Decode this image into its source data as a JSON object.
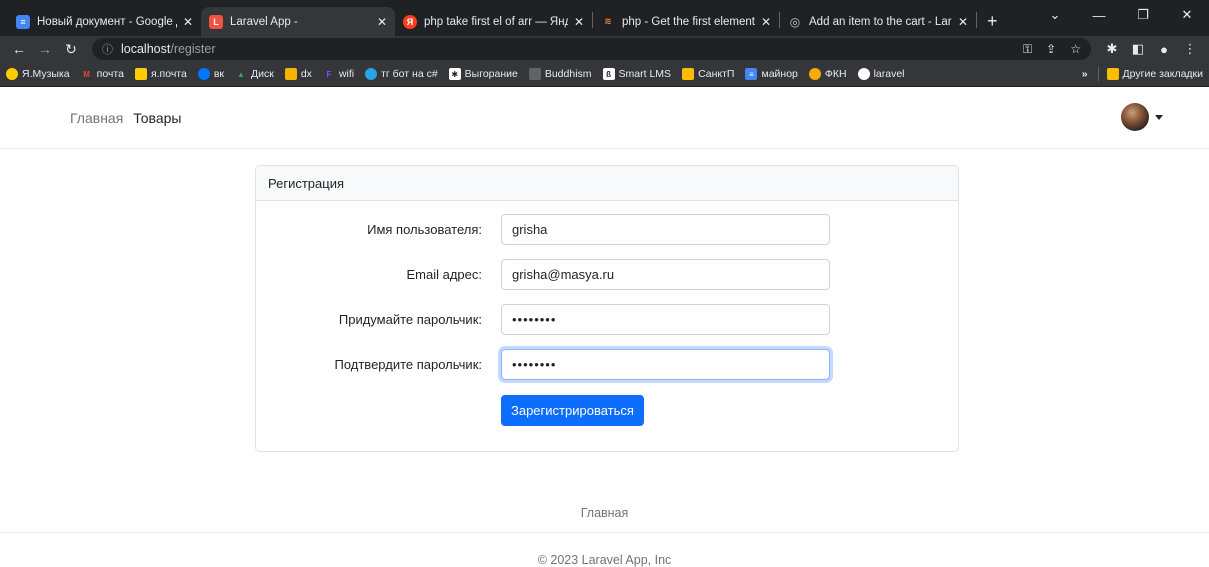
{
  "browser": {
    "tabs": [
      {
        "title": "Новый документ - Google Док",
        "favicon_color": "#4285f4",
        "favicon_glyph": "≡",
        "active": false
      },
      {
        "title": "Laravel App -",
        "favicon_color": "#f05340",
        "favicon_glyph": "L",
        "active": true
      },
      {
        "title": "php take first el of arr — Яндек",
        "favicon_color": "#fc3f1d",
        "favicon_glyph": "Я",
        "active": false
      },
      {
        "title": "php - Get the first element of ar",
        "favicon_color": "#f48024",
        "favicon_glyph": "S",
        "active": false
      },
      {
        "title": "Add an item to the cart - Larave",
        "favicon_color": "#9aa0a6",
        "favicon_glyph": "◎",
        "active": false
      }
    ],
    "url_host": "localhost",
    "url_path": "/register",
    "bookmarks": [
      {
        "label": "Я.Музыка",
        "color": "#ffcc00"
      },
      {
        "label": "почта",
        "color": "#ea4335"
      },
      {
        "label": "я.почта",
        "color": "#ffcc00"
      },
      {
        "label": "вк",
        "color": "#0077ff"
      },
      {
        "label": "Диск",
        "color": "#34a853"
      },
      {
        "label": "dx",
        "color": "#f4b400"
      },
      {
        "label": "wifi",
        "color": "#7c4dff"
      },
      {
        "label": "тг бот на c#",
        "color": "#26a5e4"
      },
      {
        "label": "Выгорание",
        "color": "#ffffff"
      },
      {
        "label": "Buddhism",
        "color": "#5f6368"
      },
      {
        "label": "Smart LMS",
        "color": "#ffffff"
      },
      {
        "label": "СанктП",
        "color": "#fbbc04"
      },
      {
        "label": "майнор",
        "color": "#4285f4"
      },
      {
        "label": "ФКН",
        "color": "#f9ab00"
      },
      {
        "label": "laravel",
        "color": "#ffffff"
      }
    ],
    "other_bookmarks": "Другие закладки",
    "more_bookmarks": "»"
  },
  "navbar": {
    "home": "Главная",
    "goods": "Товары"
  },
  "card": {
    "header": "Регистрация",
    "fields": [
      {
        "label": "Имя пользователя:",
        "value": "grisha",
        "type": "text"
      },
      {
        "label": "Email адрес:",
        "value": "grisha@masya.ru",
        "type": "email"
      },
      {
        "label": "Придумайте парольчик:",
        "value": "••••••••",
        "type": "password"
      },
      {
        "label": "Подтвердите парольчик:",
        "value": "••••••••",
        "type": "password"
      }
    ],
    "submit": "Зарегистрироваться"
  },
  "footer": {
    "link": "Главная",
    "copyright": "© 2023 Laravel App, Inc"
  },
  "colors": {
    "primary": "#0d6efd",
    "chrome_dark": "#202124",
    "chrome_mid": "#35363a"
  }
}
